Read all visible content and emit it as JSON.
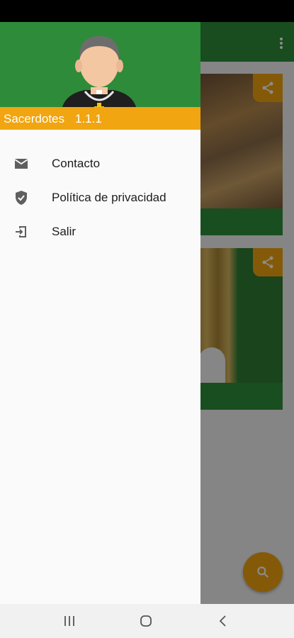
{
  "drawer": {
    "app_name": "Sacerdotes",
    "version": "1.1.1",
    "menu": [
      {
        "label": "Contacto",
        "icon": "mail-icon"
      },
      {
        "label": "Política de privacidad",
        "icon": "shield-check-icon"
      },
      {
        "label": "Salir",
        "icon": "logout-icon"
      }
    ]
  },
  "colors": {
    "primary_green": "#2e8b3a",
    "accent_amber": "#f0a511",
    "drawer_bg": "#fafafa"
  },
  "navigation": {
    "recents": "recents-icon",
    "home": "home-icon",
    "back": "back-icon"
  }
}
